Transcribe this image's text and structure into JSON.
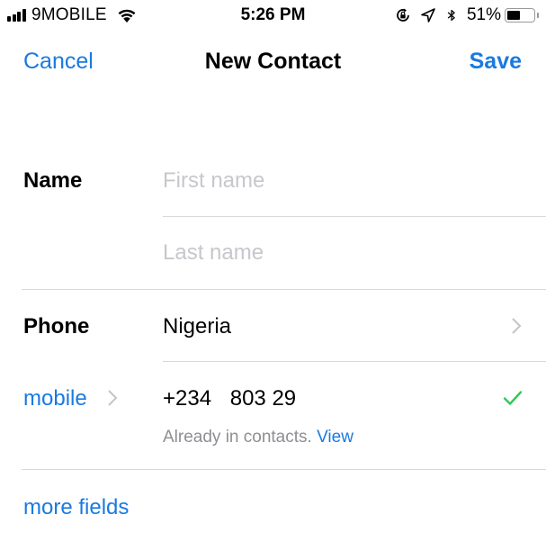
{
  "status_bar": {
    "carrier": "9MOBILE",
    "time": "5:26 PM",
    "battery_percent_label": "51%",
    "battery_level": 0.51,
    "icons": [
      "signal-icon",
      "wifi-icon",
      "orientation-lock-icon",
      "location-icon",
      "bluetooth-icon",
      "battery-icon"
    ]
  },
  "nav": {
    "cancel_label": "Cancel",
    "title": "New Contact",
    "save_label": "Save"
  },
  "form": {
    "name": {
      "label": "Name",
      "first_name_placeholder": "First name",
      "first_name_value": "",
      "last_name_placeholder": "Last name",
      "last_name_value": ""
    },
    "phone": {
      "label": "Phone",
      "country": "Nigeria",
      "type_label": "mobile",
      "country_code": "+234",
      "number": "803 29",
      "already_in_contacts_text": "Already in contacts.",
      "view_link": "View"
    },
    "more_fields_label": "more fields"
  },
  "colors": {
    "accent": "#1a7ae0",
    "placeholder": "#c7c7cc",
    "check": "#34c759",
    "divider": "#d9d9dc"
  }
}
